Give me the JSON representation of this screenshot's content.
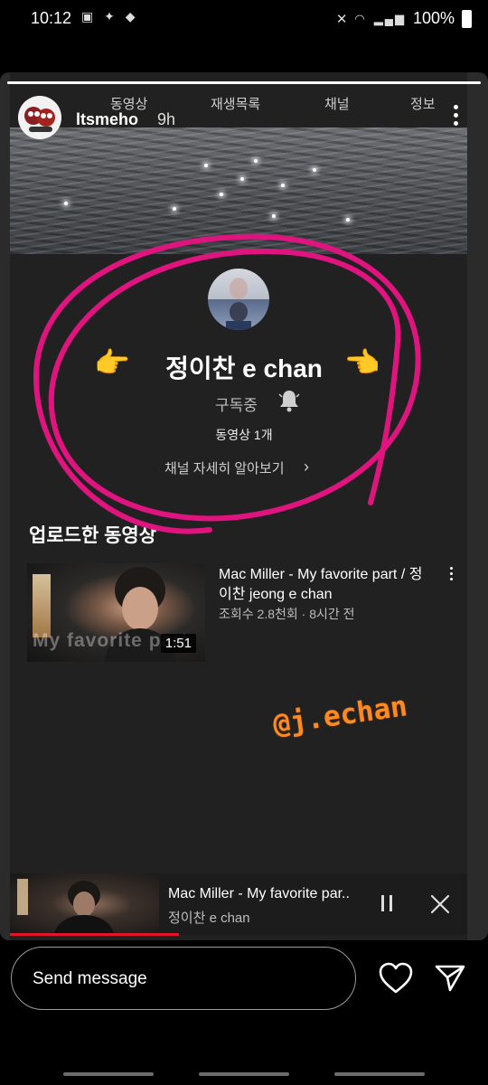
{
  "status_bar": {
    "time": "10:12",
    "battery": "100%"
  },
  "story": {
    "progress_fraction": 1.0,
    "username": "ltsmeho",
    "time_ago": "9h"
  },
  "youtube": {
    "tabs": [
      "동영상",
      "재생목록",
      "채널",
      "정보"
    ],
    "channel_name": "정이찬 e chan",
    "hand_emoji": "👉",
    "subscribed_label": "구독중",
    "video_count": "동영상 1개",
    "learn_more": "채널 자세히 알아보기",
    "uploads_title": "업로드한 동영상",
    "video": {
      "title": "Mac Miller - My favorite part / 정이찬 jeong e chan",
      "meta": "조회수 2.8천회 · 8시간 전",
      "duration": "1:51",
      "thumb_watermark": "My favorite part"
    },
    "mini_player": {
      "title": "Mac Miller - My favorite par..",
      "subtitle": "정이찬 e chan",
      "progress_fraction": 0.37
    }
  },
  "sticker_text": "@j.echan",
  "message_bar": {
    "placeholder": "Send message"
  },
  "colors": {
    "circle_annotation": "#e0147f",
    "sticker": "#ff8a1f",
    "mini_progress": "#e0142b"
  }
}
